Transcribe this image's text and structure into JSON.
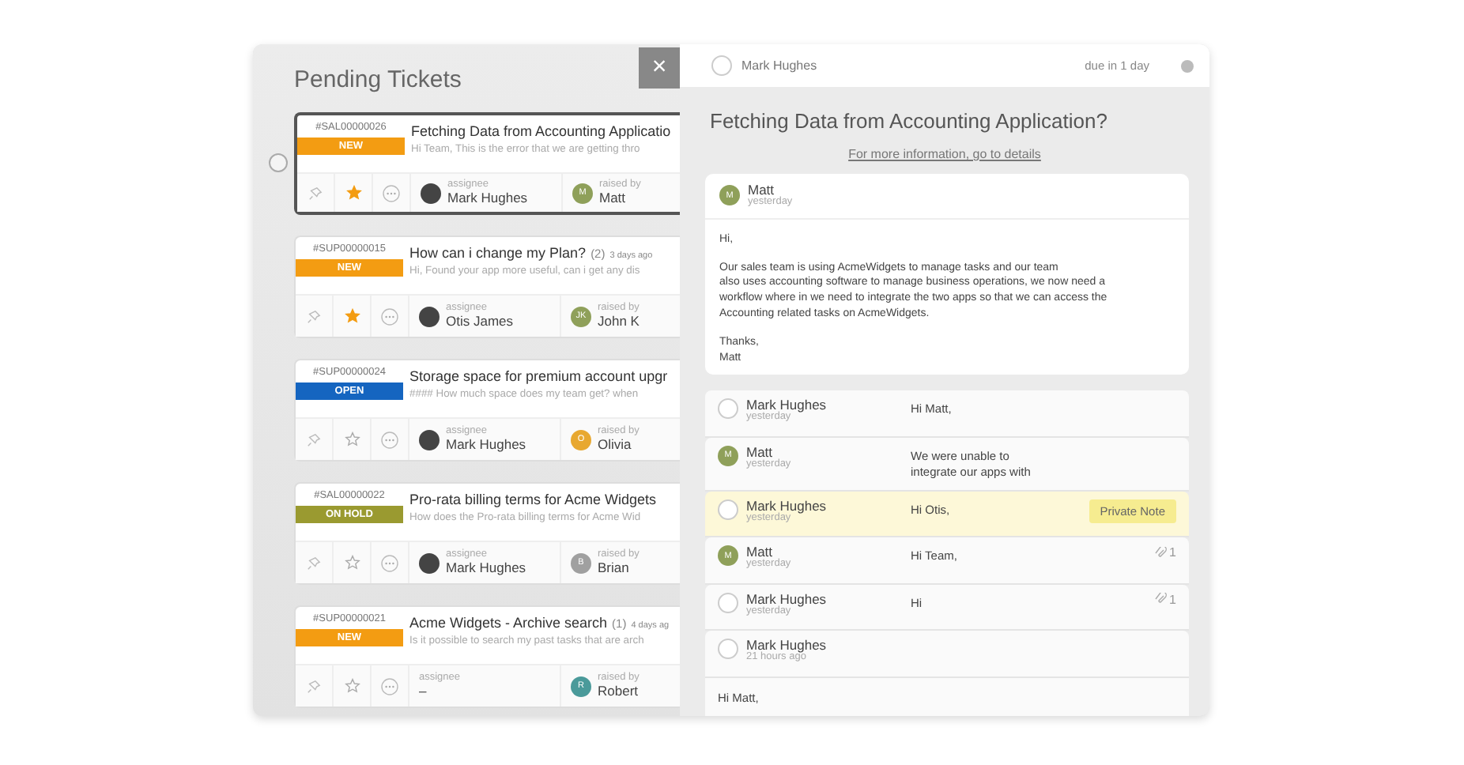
{
  "left_panel": {
    "title": "Pending Tickets",
    "close": "×"
  },
  "tickets": [
    {
      "id": "#SAL00000026",
      "status": {
        "label": "NEW",
        "kind": "new"
      },
      "title": "Fetching Data from Accounting Applicatio",
      "preview": "Hi Team, This is the error that we are getting thro",
      "assignee_label": "assignee",
      "assignee": "Mark Hughes",
      "raised_by_label": "raised by",
      "raiser": {
        "name": "Matt",
        "initial": "M",
        "color": "#8fa05a"
      },
      "starred": true,
      "selected": true
    },
    {
      "id": "#SUP00000015",
      "status": {
        "label": "NEW",
        "kind": "new"
      },
      "title": "How can i change my Plan?",
      "count": "(2)",
      "age": "3 days ago",
      "preview": "Hi, Found your app more useful, can i get any dis",
      "assignee_label": "assignee",
      "assignee": "Otis James",
      "raised_by_label": "raised by",
      "raiser": {
        "name": "John K",
        "initial": "JK",
        "color": "#8fa05a"
      },
      "starred": true,
      "selected": false
    },
    {
      "id": "#SUP00000024",
      "status": {
        "label": "OPEN",
        "kind": "open"
      },
      "title": "Storage space for premium account upgr",
      "preview": "#### How much space does my team get? when",
      "assignee_label": "assignee",
      "assignee": "Mark Hughes",
      "raised_by_label": "raised by",
      "raiser": {
        "name": "Olivia",
        "initial": "O",
        "color": "#e8a830"
      },
      "starred": false,
      "selected": false
    },
    {
      "id": "#SAL00000022",
      "status": {
        "label": "ON HOLD",
        "kind": "on_hold"
      },
      "title": "Pro-rata billing terms for Acme Widgets",
      "preview": "How does the Pro-rata billing terms for Acme Wid",
      "assignee_label": "assignee",
      "assignee": "Mark Hughes",
      "raised_by_label": "raised by",
      "raiser": {
        "name": "Brian",
        "initial": "B",
        "color": "#a0a0a0"
      },
      "starred": false,
      "selected": false
    },
    {
      "id": "#SUP00000021",
      "status": {
        "label": "NEW",
        "kind": "new"
      },
      "title": "Acme Widgets - Archive search",
      "count": "(1)",
      "age": "4 days ag",
      "preview": "Is it possible to search my past tasks that are arch",
      "assignee_label": "assignee",
      "assignee": "–",
      "raised_by_label": "raised by",
      "raiser": {
        "name": "Robert",
        "initial": "R",
        "color": "#4a9a9a"
      },
      "starred": false,
      "selected": false
    }
  ],
  "detail": {
    "assignee": "Mark Hughes",
    "due": "due in 1 day",
    "title": "Fetching Data from Accounting Application?",
    "link": "For more information, go to details",
    "message": {
      "author": "Matt",
      "initial": "M",
      "time": "yesterday",
      "paragraphs": [
        "Hi,",
        "Our sales team is using AcmeWidgets to manage tasks and our team\nalso uses accounting software to manage business operations, we now need a\nworkflow where in we need to integrate the two apps so that we can access the\nAccounting related tasks on AcmeWidgets.",
        "Thanks,\nMatt"
      ]
    }
  },
  "conversation": [
    {
      "kind": "agent",
      "author_name": "Mark Hughes",
      "time": "yesterday",
      "text": "Hi Matt,",
      "private": false
    },
    {
      "kind": "customer",
      "initial": "M",
      "author_name": "Matt",
      "time": "yesterday",
      "text": "We were unable to\nintegrate our apps with",
      "private": false
    },
    {
      "kind": "agent",
      "author_name": "Mark Hughes",
      "time": "yesterday",
      "text": "Hi Otis,",
      "private": true,
      "note_label": "Private Note"
    },
    {
      "kind": "customer",
      "initial": "M",
      "author_name": "Matt",
      "time": "yesterday",
      "text": "Hi Team,",
      "private": false,
      "attachments": "1"
    },
    {
      "kind": "agent",
      "author_name": "Mark Hughes",
      "time": "yesterday",
      "text": "Hi",
      "private": false,
      "attachments": "1"
    },
    {
      "kind": "agent",
      "author_name": "Mark Hughes",
      "time": "21 hours ago",
      "private": false,
      "body": "Hi Matt,"
    }
  ]
}
